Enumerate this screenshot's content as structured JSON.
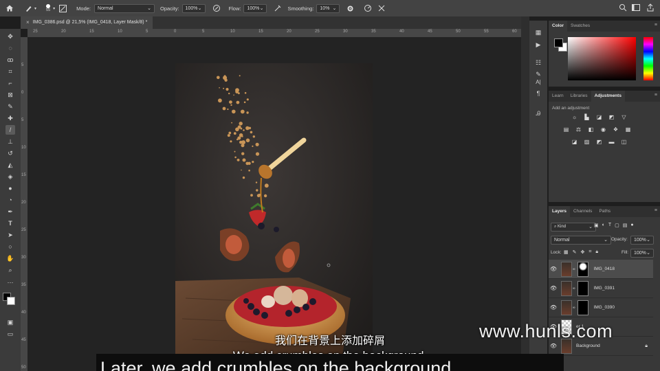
{
  "options_bar": {
    "brush_size": "55",
    "mode_label": "Mode:",
    "mode_value": "Normal",
    "opacity_label": "Opacity:",
    "opacity_value": "100%",
    "flow_label": "Flow:",
    "flow_value": "100%",
    "smoothing_label": "Smoothing:",
    "smoothing_value": "10%"
  },
  "document": {
    "tab_title": "IMG_0386.psd @ 21,5% (IMG_0418, Layer Mask/8) *"
  },
  "rulers": {
    "horizontal": [
      "25",
      "20",
      "15",
      "10",
      "5",
      "0",
      "5",
      "10",
      "15",
      "20",
      "25",
      "30",
      "35",
      "40",
      "45",
      "50",
      "55",
      "60"
    ],
    "vertical": [
      "5",
      "0",
      "5",
      "10",
      "15",
      "20",
      "25",
      "30",
      "35",
      "40",
      "45",
      "50"
    ]
  },
  "color_panel": {
    "tabs": [
      "Color",
      "Swatches"
    ],
    "active_tab": "Color"
  },
  "adjustments_panel": {
    "tabs": [
      "Learn",
      "Libraries",
      "Adjustments"
    ],
    "active_tab": "Adjustments",
    "hint": "Add an adjustment"
  },
  "layers_panel": {
    "tabs": [
      "Layers",
      "Channels",
      "Paths"
    ],
    "active_tab": "Layers",
    "filter_value": "Kind",
    "blend_mode": "Normal",
    "opacity_label": "Opacity:",
    "opacity_value": "100%",
    "lock_label": "Lock:",
    "fill_label": "Fill:",
    "fill_value": "100%",
    "layers": [
      {
        "name": "IMG_0418"
      },
      {
        "name": "IMG_0391"
      },
      {
        "name": "IMG_0390"
      },
      {
        "name": "er 1"
      },
      {
        "name": "Background"
      }
    ]
  },
  "watermark": "www.hunls.com",
  "subtitles": {
    "chinese": "我们在背景上添加碎屑",
    "english": "We add crumbles on the background.",
    "overlay": "Later, we add crumbles on the background"
  },
  "colors": {
    "foreground": "#000000",
    "background": "#ffffff",
    "picker_hue": "#ff0000",
    "selected_layer": "#4c4c4c"
  }
}
